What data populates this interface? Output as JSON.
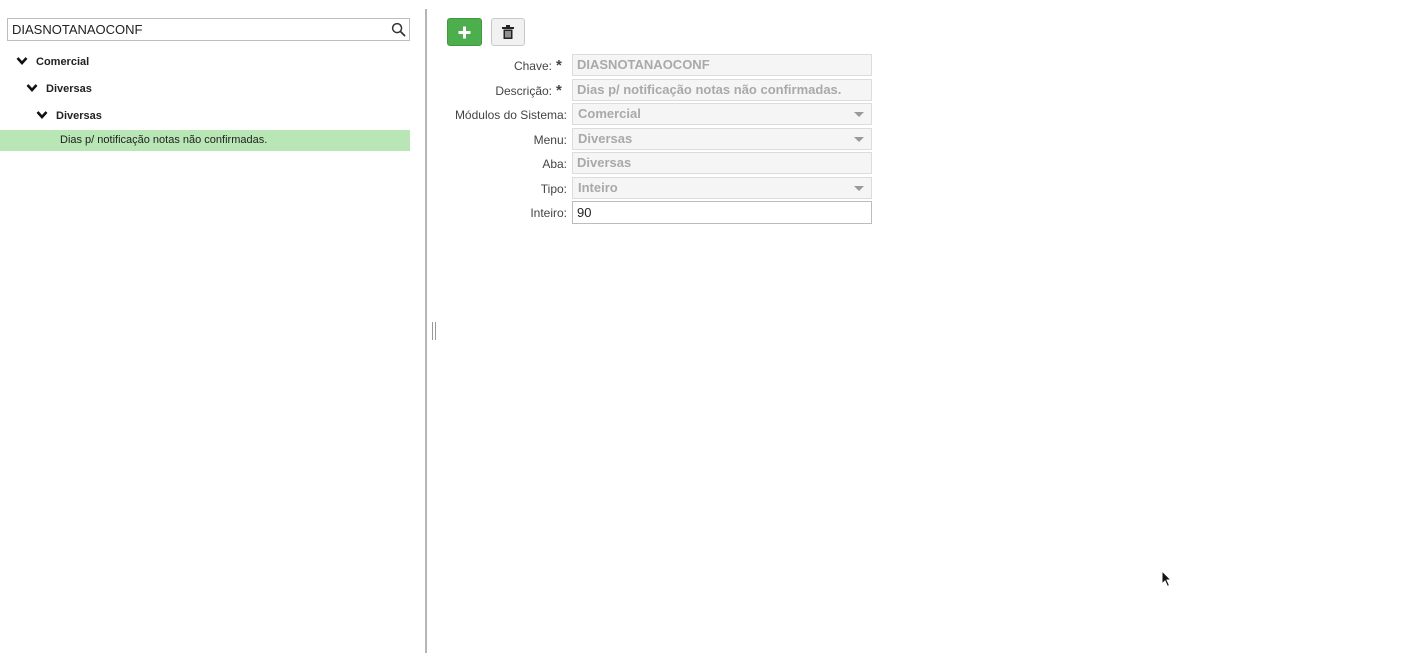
{
  "search": {
    "value": "DIASNOTANAOCONF"
  },
  "tree": {
    "nodes": [
      {
        "label": "Comercial"
      },
      {
        "label": "Diversas"
      },
      {
        "label": "Diversas"
      }
    ],
    "selected_leaf": "Dias p/ notificação notas não confirmadas.",
    "selected_color": "#b8e6b4"
  },
  "toolbar": {
    "add_icon": "plus-icon",
    "delete_icon": "trash-icon",
    "add_color": "#4cae4c"
  },
  "form": {
    "chave": {
      "label": "Chave:",
      "value": "DIASNOTANAOCONF",
      "required_mark": "*"
    },
    "descricao": {
      "label": "Descrição:",
      "value": "Dias p/ notificação notas não confirmadas.",
      "required_mark": "*"
    },
    "modulos": {
      "label": "Módulos do Sistema:",
      "value": "Comercial"
    },
    "menu": {
      "label": "Menu:",
      "value": "Diversas"
    },
    "aba": {
      "label": "Aba:",
      "value": "Diversas"
    },
    "tipo": {
      "label": "Tipo:",
      "value": "Inteiro"
    },
    "inteiro": {
      "label": "Inteiro:",
      "value": "90"
    }
  }
}
